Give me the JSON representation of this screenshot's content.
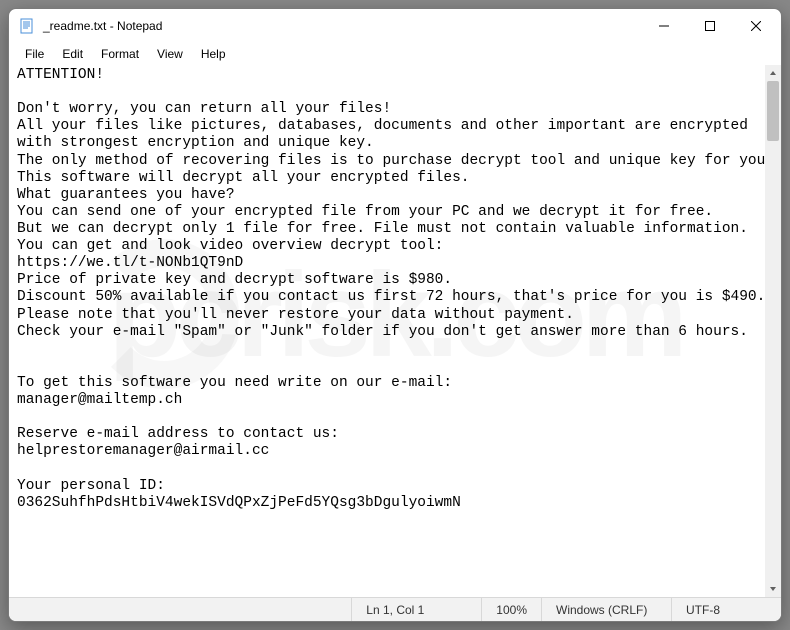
{
  "window": {
    "title": "_readme.txt - Notepad"
  },
  "menu": {
    "file": "File",
    "edit": "Edit",
    "format": "Format",
    "view": "View",
    "help": "Help"
  },
  "content": "ATTENTION!\n\nDon't worry, you can return all your files!\nAll your files like pictures, databases, documents and other important are encrypted with strongest encryption and unique key.\nThe only method of recovering files is to purchase decrypt tool and unique key for you.\nThis software will decrypt all your encrypted files.\nWhat guarantees you have?\nYou can send one of your encrypted file from your PC and we decrypt it for free.\nBut we can decrypt only 1 file for free. File must not contain valuable information.\nYou can get and look video overview decrypt tool:\nhttps://we.tl/t-NONb1QT9nD\nPrice of private key and decrypt software is $980.\nDiscount 50% available if you contact us first 72 hours, that's price for you is $490.\nPlease note that you'll never restore your data without payment.\nCheck your e-mail \"Spam\" or \"Junk\" folder if you don't get answer more than 6 hours.\n\n\nTo get this software you need write on our e-mail:\nmanager@mailtemp.ch\n\nReserve e-mail address to contact us:\nhelprestoremanager@airmail.cc\n\nYour personal ID:\n0362SuhfhPdsHtbiV4wekISVdQPxZjPeFd5YQsg3bDgulyoiwmN",
  "status": {
    "position": "Ln 1, Col 1",
    "zoom": "100%",
    "eol": "Windows (CRLF)",
    "encoding": "UTF-8"
  }
}
